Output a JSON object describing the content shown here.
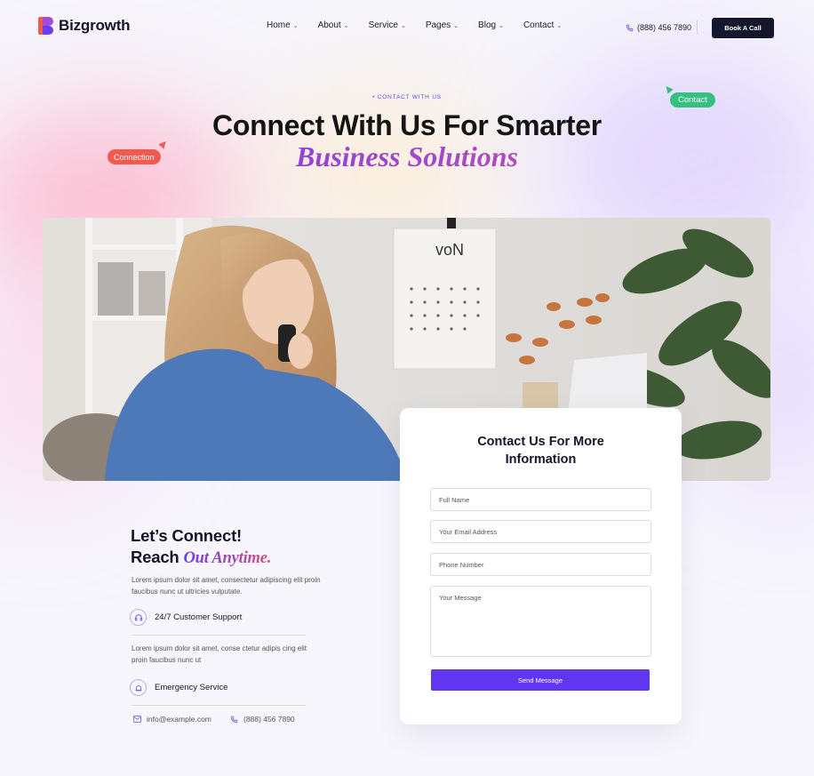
{
  "brand": {
    "name": "Bizgrowth"
  },
  "nav": {
    "items": [
      {
        "label": "Home"
      },
      {
        "label": "About"
      },
      {
        "label": "Service"
      },
      {
        "label": "Pages"
      },
      {
        "label": "Blog"
      },
      {
        "label": "Contact"
      }
    ],
    "dropdown_glyph": "⌄"
  },
  "header": {
    "phone": "(888) 456 7890",
    "cta_label": "Book A Call"
  },
  "hero": {
    "eyebrow": "• CONTACT WITH US",
    "title_line1": "Connect With Us For Smarter",
    "title_line2": "Business Solutions",
    "tag_left": "Connection",
    "tag_right": "Contact"
  },
  "photo": {
    "calendar_text": "voN"
  },
  "form": {
    "title_line1": "Contact Us For More",
    "title_line2": "Information",
    "full_name_placeholder": "Full Name",
    "email_placeholder": "Your Email Address",
    "phone_placeholder": "Phone Number",
    "message_placeholder": "Your Message",
    "submit_label": "Send Message"
  },
  "info": {
    "heading_line1": "Let’s Connect!",
    "heading_line2_plain": "Reach",
    "heading_line2_accent": "Out Anytime.",
    "intro": "Lorem ipsum dolor sit amet, consectetur adipiscing elit proin faucibus nunc ut ultricies vulputate.",
    "feature1": "24/7 Customer Support",
    "feature1_text": "Lorem ipsum dolor sit amet, conse ctetur adipis cing elit proin faucibus nunc ut",
    "feature2": "Emergency Service",
    "email": "info@example.com",
    "phone": "(888) 456 7890"
  },
  "colors": {
    "brand_purple": "#6236f0",
    "tag_red": "#f05a4f",
    "tag_green": "#35c07f",
    "dark": "#14162b"
  }
}
